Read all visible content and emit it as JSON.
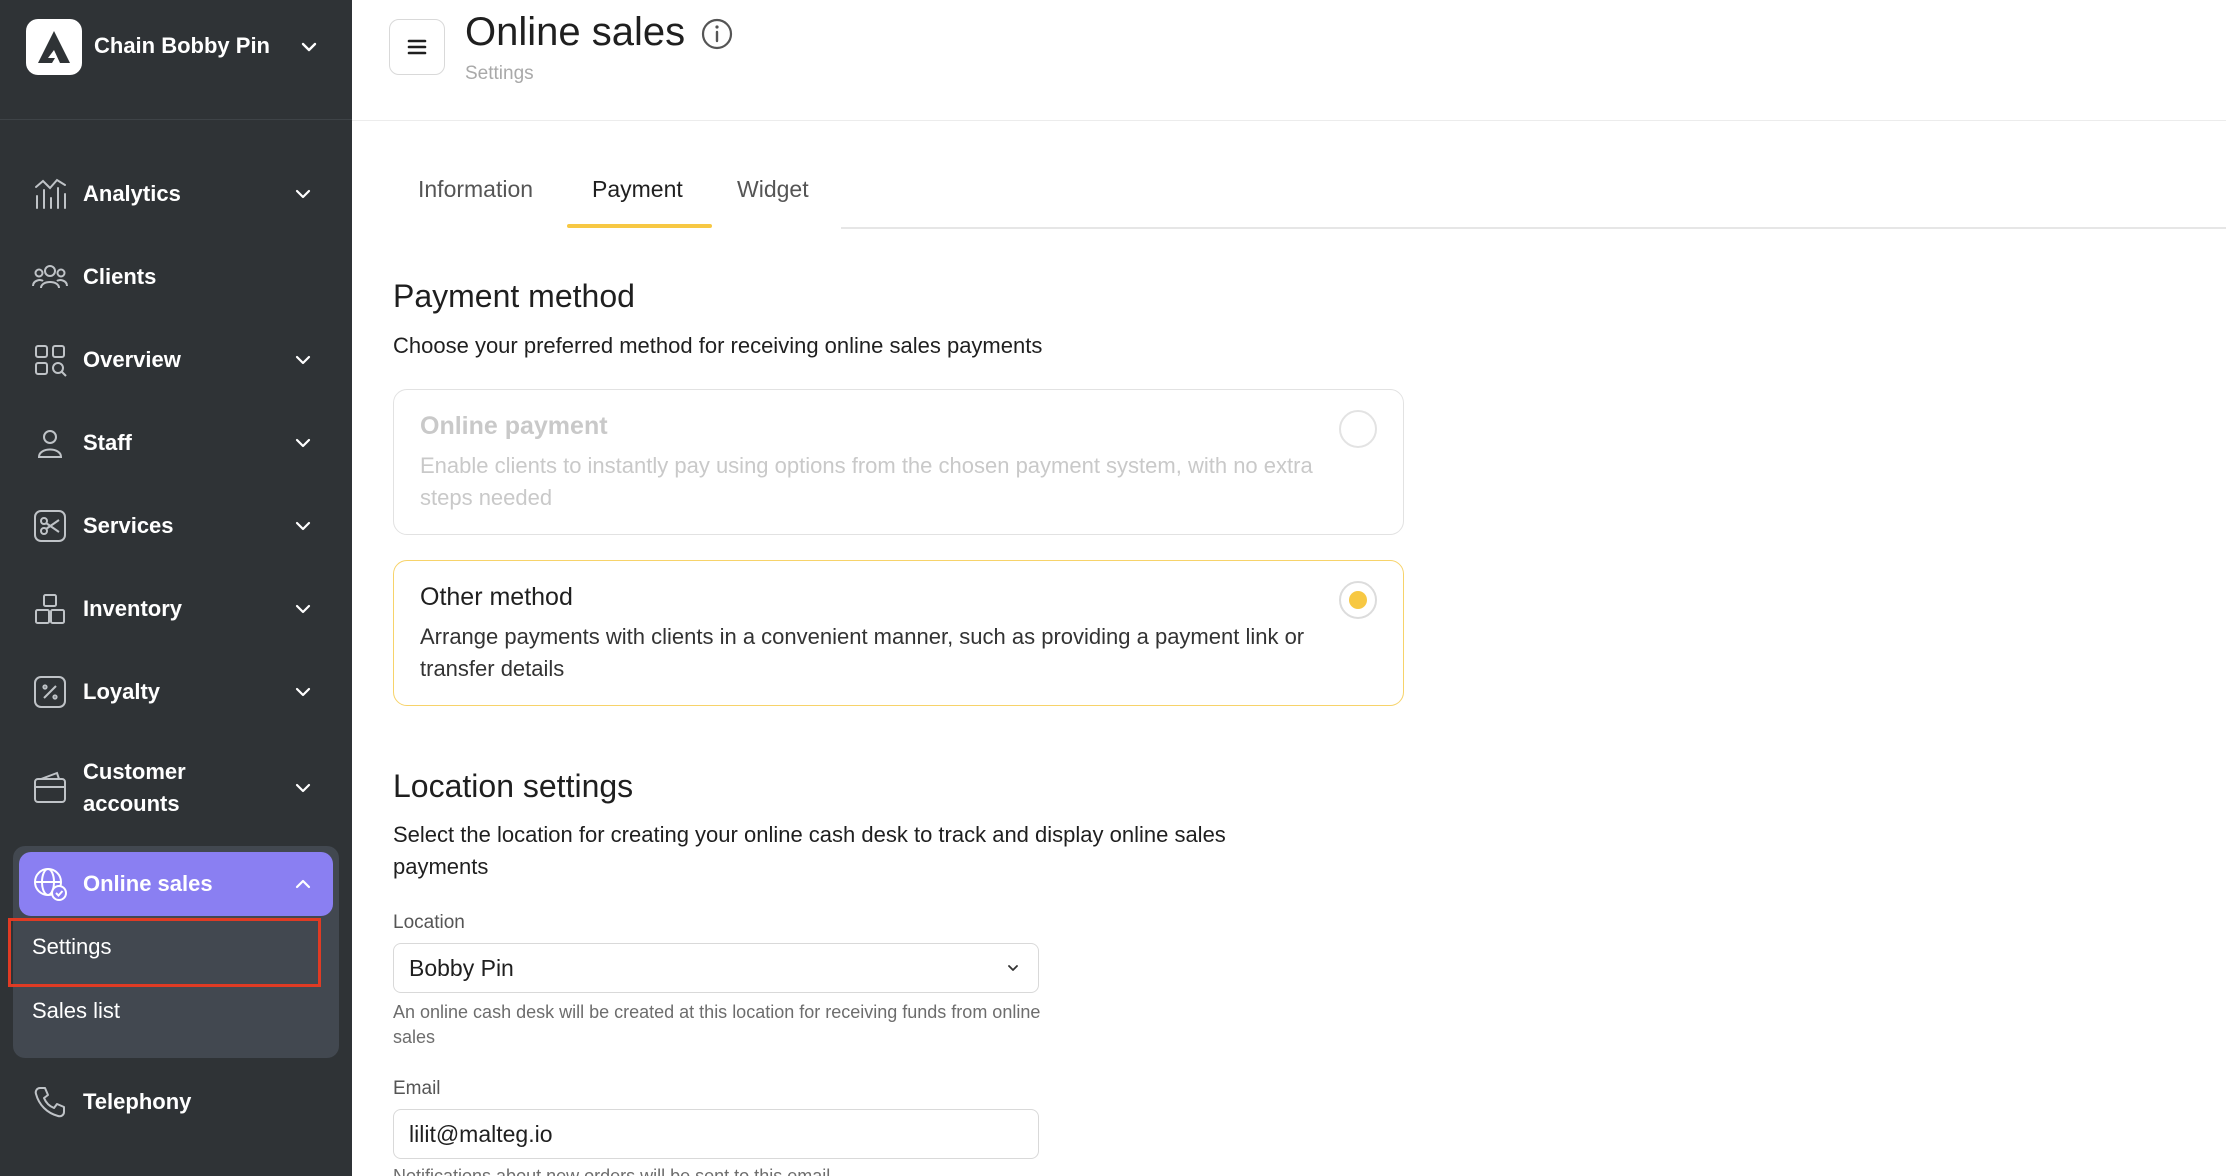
{
  "brand": {
    "name": "Chain Bobby Pin"
  },
  "sidebar": {
    "items": [
      {
        "label": "Analytics",
        "icon": "analytics-icon",
        "expandable": true
      },
      {
        "label": "Clients",
        "icon": "clients-icon",
        "expandable": false
      },
      {
        "label": "Overview",
        "icon": "overview-icon",
        "expandable": true
      },
      {
        "label": "Staff",
        "icon": "staff-icon",
        "expandable": true
      },
      {
        "label": "Services",
        "icon": "scissors-icon",
        "expandable": true
      },
      {
        "label": "Inventory",
        "icon": "inventory-icon",
        "expandable": true
      },
      {
        "label": "Loyalty",
        "icon": "percent-icon",
        "expandable": true
      },
      {
        "label": "Customer accounts",
        "icon": "wallet-icon",
        "expandable": true
      },
      {
        "label": "Online sales",
        "icon": "globe-icon",
        "expandable": true,
        "active": true
      },
      {
        "label": "Telephony",
        "icon": "phone-icon",
        "expandable": false
      }
    ],
    "online_sales_sub": [
      {
        "label": "Settings",
        "highlighted": true
      },
      {
        "label": "Sales list"
      }
    ],
    "accent_color": "#8a7ff2",
    "highlight_color": "#e03b24"
  },
  "header": {
    "title": "Online sales",
    "breadcrumb": "Settings"
  },
  "tabs": [
    {
      "label": "Information",
      "active": false
    },
    {
      "label": "Payment",
      "active": true
    },
    {
      "label": "Widget",
      "active": false
    }
  ],
  "payment": {
    "title": "Payment method",
    "description": "Choose your preferred method for receiving online sales payments",
    "options": [
      {
        "title": "Online payment",
        "description": "Enable clients to instantly pay using options from the chosen payment system, with no extra steps needed",
        "disabled": true,
        "selected": false
      },
      {
        "title": "Other method",
        "description": "Arrange payments with clients in a convenient manner, such as providing a payment link or transfer details",
        "disabled": false,
        "selected": true
      }
    ]
  },
  "location": {
    "title": "Location settings",
    "description": "Select the location for creating your online cash desk to track and display online sales payments",
    "location_label": "Location",
    "location_value": "Bobby Pin",
    "location_hint": "An online cash desk will be created at this location for receiving funds from online sales",
    "email_label": "Email",
    "email_value": "lilit@malteg.io",
    "email_hint": "Notifications about new orders will be sent to this email"
  }
}
